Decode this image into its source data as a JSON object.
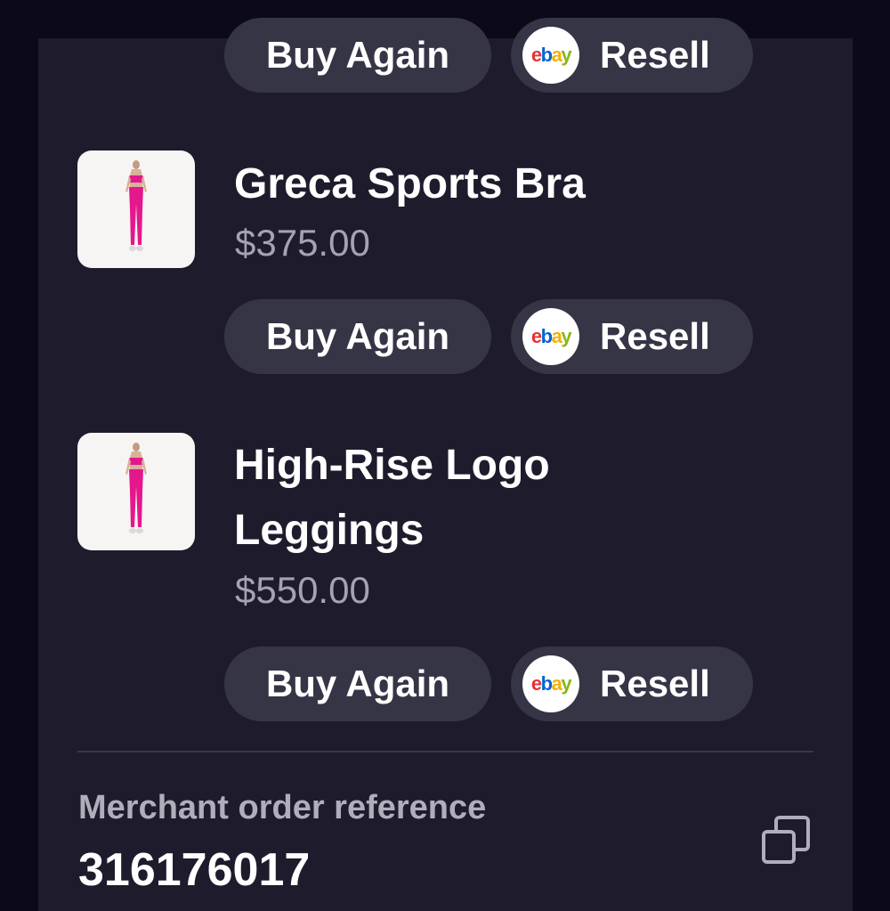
{
  "items": [
    {
      "buy_again_label": "Buy Again",
      "resell_label": "Resell",
      "ebay_icon": "ebay-logo-icon"
    },
    {
      "name": "Greca Sports Bra",
      "price": "$375.00",
      "buy_again_label": "Buy Again",
      "resell_label": "Resell",
      "ebay_icon": "ebay-logo-icon"
    },
    {
      "name_line1": "High-Rise Logo",
      "name_line2": "Leggings",
      "price": "$550.00",
      "buy_again_label": "Buy Again",
      "resell_label": "Resell",
      "ebay_icon": "ebay-logo-icon"
    }
  ],
  "merchant": {
    "label": "Merchant order reference",
    "value": "316176017",
    "copy_icon": "copy-icon"
  },
  "colors": {
    "background": "#0c0918",
    "card": "#1e1b2c",
    "button": "#363546",
    "text_primary": "#ffffff",
    "text_secondary": "#a5a3b1",
    "product_pink": "#e5178c"
  }
}
